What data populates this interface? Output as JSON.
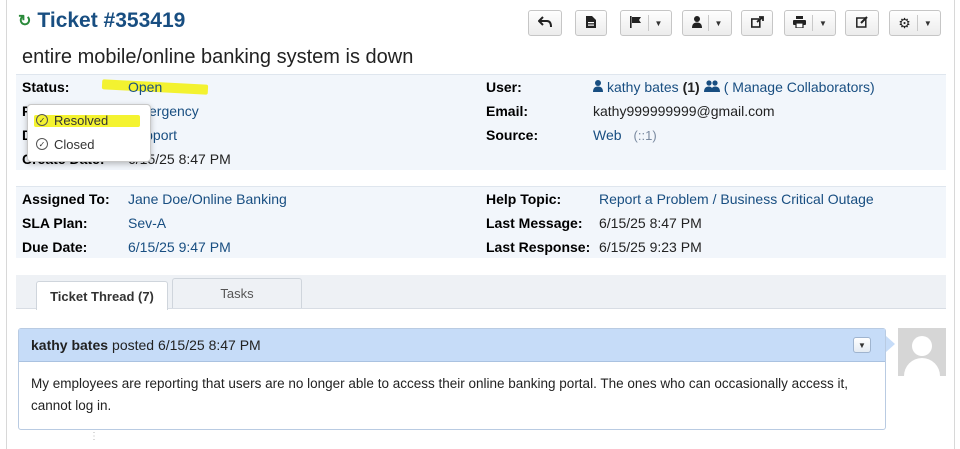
{
  "ticket": {
    "number": "Ticket #353419",
    "subject": "entire mobile/online banking system is down"
  },
  "icons": {
    "refresh": "refresh-icon",
    "reply": "reply-icon",
    "print_doc": "document-icon",
    "flag": "flag-icon",
    "assign": "user-icon",
    "share": "share-icon",
    "printer": "printer-icon",
    "edit": "edit-icon",
    "settings": "gear-icon"
  },
  "info": {
    "status_label": "Status:",
    "status_value": "Open",
    "priority_value": "Emergency",
    "department_value": "Support",
    "create_date_label": "Create Date:",
    "create_date_value": "6/15/25 8:47 PM",
    "user_label": "User:",
    "user_name": "kathy bates",
    "user_count": "(1)",
    "manage_collaborators": "( Manage Collaborators)",
    "email_label": "Email:",
    "email_value": "kathy999999999@gmail.com",
    "source_label": "Source:",
    "source_value": "Web",
    "source_ip": "(::1)"
  },
  "status_dropdown": {
    "items": [
      "Resolved",
      "Closed"
    ]
  },
  "assignment": {
    "assigned_label": "Assigned To:",
    "assigned_value": "Jane Doe/Online Banking",
    "sla_label": "SLA Plan:",
    "sla_value": "Sev-A",
    "due_label": "Due Date:",
    "due_value": "6/15/25 9:47 PM",
    "help_topic_label": "Help Topic:",
    "help_topic_value": "Report a Problem / Business Critical Outage",
    "last_message_label": "Last Message:",
    "last_message_value": "6/15/25 8:47 PM",
    "last_response_label": "Last Response:",
    "last_response_value": "6/15/25 9:23 PM"
  },
  "tabs": [
    {
      "label": "Ticket Thread (7)"
    },
    {
      "label": "Tasks"
    }
  ],
  "thread": {
    "author": "kathy bates",
    "posted": "posted 6/15/25 8:47 PM",
    "body": "My employees are reporting that users are no longer able to access their online banking portal. The ones who can occasionally access it, cannot log in."
  },
  "colors": {
    "link": "#184e81",
    "highlight": "#f3f21a",
    "thread_header": "#c6dcf8",
    "panel": "#f2f6fb"
  }
}
